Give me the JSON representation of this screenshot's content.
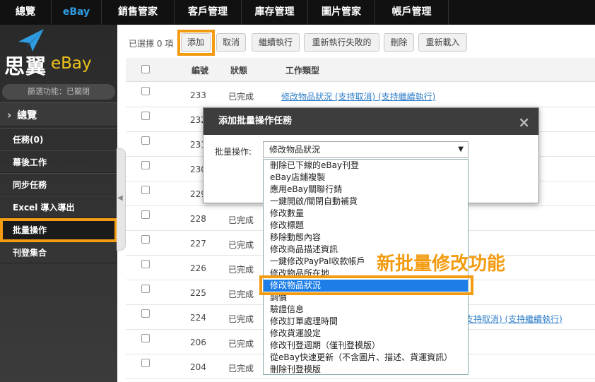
{
  "topnav": {
    "items": [
      "總覽",
      "eBay",
      "銷售管家",
      "客戶管理",
      "庫存管理",
      "圖片管家",
      "帳戶管理"
    ]
  },
  "brand": {
    "name_cn": "思翼",
    "name_en": "eBay"
  },
  "sidebar": {
    "filter_status": "篩選功能：已關閉",
    "overview": "總覽",
    "items": [
      "任務(0)",
      "幕後工作",
      "同步任務",
      "Excel 導入導出",
      "批量操作",
      "刊登集合"
    ]
  },
  "toolbar": {
    "selected_count": "已選擇 0 項",
    "buttons": [
      "添加",
      "取消",
      "繼續執行",
      "重新執行失敗的",
      "刪除",
      "重新載入"
    ]
  },
  "table": {
    "headers": [
      "編號",
      "狀態",
      "工作類型"
    ],
    "rows": [
      {
        "id": "233",
        "status": "已完成",
        "type": "修改物品狀況 (支持取消) (支持繼續執行)"
      },
      {
        "id": "232",
        "status": "",
        "type": ""
      },
      {
        "id": "231",
        "status": "",
        "type": ""
      },
      {
        "id": "230",
        "status": "",
        "type": ""
      },
      {
        "id": "229",
        "status": "",
        "type": ""
      },
      {
        "id": "228",
        "status": "已完成",
        "type": ""
      },
      {
        "id": "227",
        "status": "已完成",
        "type": ""
      },
      {
        "id": "226",
        "status": "已完成",
        "type": ""
      },
      {
        "id": "225",
        "status": "已完成",
        "type": ""
      },
      {
        "id": "224",
        "status": "已完成",
        "type": "支持取消) (支持繼續執行)"
      },
      {
        "id": "206",
        "status": "已完成",
        "type": ""
      },
      {
        "id": "204",
        "status": "已完成",
        "type": ""
      }
    ]
  },
  "modal": {
    "title": "添加批量操作任務",
    "close": "×",
    "label": "批量操作:",
    "selected_value": "修改物品狀況",
    "options": [
      "刪除已下線的eBay刊登",
      "eBay店鋪複製",
      "應用eBay關聯行銷",
      "一鍵開啟/關閉自動補貨",
      "修改數量",
      "修改標題",
      "移除動態內容",
      "修改商品描述資訊",
      "一鍵修改PayPal收款帳戶",
      "修改物品所在地",
      "修改物品狀況",
      "調價",
      "驗證信息",
      "修改訂單處理時間",
      "修改貨運設定",
      "修改刊登週期（僅刊登模版）",
      "從eBay快速更新（不含圖片、描述、貨運資訊）",
      "刪除刊登模版"
    ],
    "highlighted_index": 10
  },
  "annotation": "新批量修改功能",
  "colors": {
    "accent": "#f39c12",
    "nav_active": "#2f9be0",
    "link": "#2f7fc9",
    "option_selected": "#1e7ee8"
  }
}
